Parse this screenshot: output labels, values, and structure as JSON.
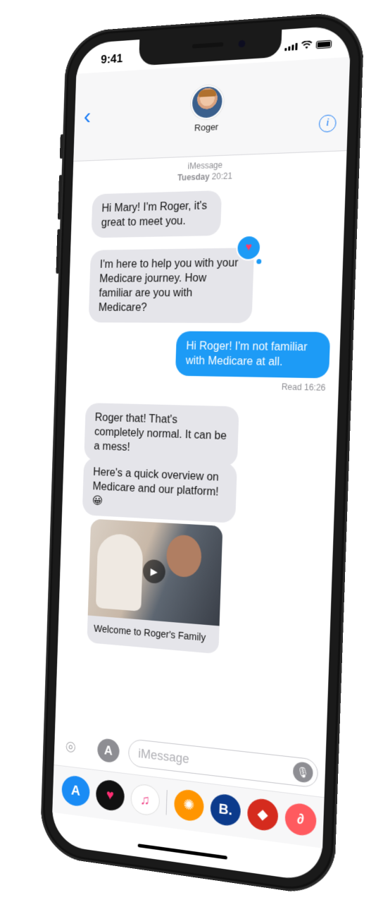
{
  "status_bar": {
    "time": "9:41"
  },
  "header": {
    "back_icon": "chevron-left-icon",
    "contact_name": "Roger",
    "info_label": "i"
  },
  "thread": {
    "service": "iMessage",
    "day": "Tuesday",
    "time": "20:21",
    "messages": [
      {
        "from": "contact",
        "text": "Hi Mary! I'm Roger, it's great to meet you."
      },
      {
        "from": "contact",
        "text": "I'm here to help you with your Medicare journey. How familiar are you with Medicare?",
        "tapback": "heart-icon",
        "tapback_glyph": "♥"
      },
      {
        "from": "me",
        "text": "Hi Roger! I'm not familiar with Medicare at all."
      },
      {
        "from": "contact",
        "text": "Roger that! That's completely normal. It can be a mess!"
      },
      {
        "from": "contact",
        "text": "Here's a quick overview on Medicare and our platform! 😀"
      }
    ],
    "read_receipt": "Read 16:26",
    "video_card": {
      "caption": "Welcome to Roger's Family",
      "play_glyph": "▶"
    }
  },
  "composer": {
    "camera_glyph": "⌾",
    "apps_glyph": "A",
    "placeholder": "iMessage",
    "mic_glyph": "🎙"
  },
  "app_drawer": {
    "apps": [
      {
        "name": "app-store-icon",
        "glyph": "A",
        "color": "#1a8cf5"
      },
      {
        "name": "heart-app-icon",
        "glyph": "♥",
        "color": "#111111"
      },
      {
        "name": "music-icon",
        "glyph": "♫",
        "color": "#ffffff"
      },
      {
        "name": "film-reel-icon",
        "glyph": "✺",
        "color": "#ff9500"
      },
      {
        "name": "booking-icon",
        "glyph": "B.",
        "color": "#0c3b8c"
      },
      {
        "name": "dog-app-icon",
        "glyph": "◆",
        "color": "#d52b1e"
      },
      {
        "name": "airbnb-icon",
        "glyph": "∂",
        "color": "#ff5a5f"
      }
    ]
  },
  "colors": {
    "accent": "#1a7cf5",
    "outgoing_bubble": "#1d9bf6",
    "incoming_bubble": "#e5e5ea"
  }
}
